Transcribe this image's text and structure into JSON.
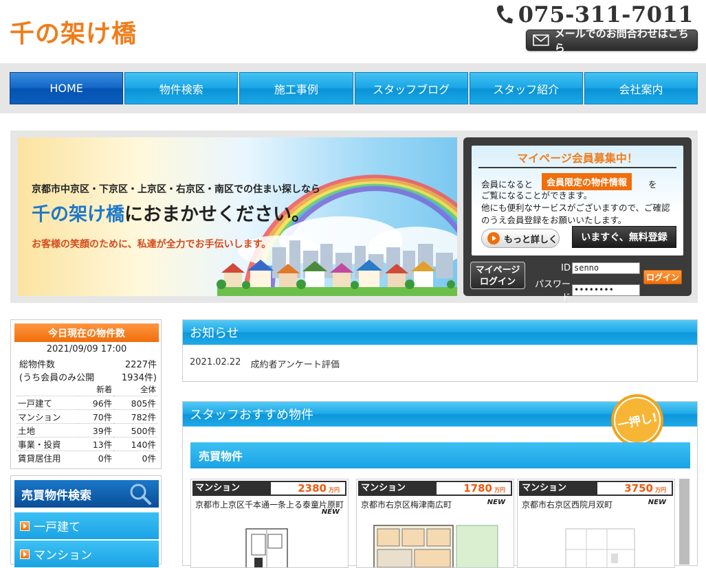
{
  "header": {
    "logo": "千の架け橋",
    "phone": "075-311-7011",
    "mail_button": "メールでのお問合わせはこちら"
  },
  "nav": {
    "items": [
      "HOME",
      "物件検索",
      "施工事例",
      "スタッフブログ",
      "スタッフ紹介",
      "会社案内"
    ],
    "active": "HOME"
  },
  "hero": {
    "line1": "京都市中京区・下京区・上京区・右京区・南区での住まい探しなら",
    "line2_brand": "千の架け橋",
    "line2_rest": "におまかせください。",
    "line3": "お客様の笑顔のために、私達が全力でお手伝いします。"
  },
  "member": {
    "title": "マイページ会員募集中！",
    "text_before_badge": "会員になると",
    "badge": "会員限定の物件情報",
    "text_after_badge": "を",
    "text_lines": [
      "ご覧になることができます。",
      "他にも便利なサービスがございますので、ご確認",
      "のうえ会員登録をお願いいたします。"
    ],
    "more_button": "もっと詳しく",
    "register_button": "いますぐ、無料登録",
    "mypage_line1": "マイページ",
    "mypage_line2": "ログイン",
    "id_label": "ID",
    "id_value": "senno",
    "password_label": "パスワード",
    "password_value": "••••••••",
    "login_button": "ログイン"
  },
  "property_count": {
    "title": "今日現在の物件数",
    "date": "2021/09/09 17:00",
    "total_label": "総物件数",
    "total_value": "2227件",
    "members_label": "(うち会員のみ公開",
    "members_value": "1934件)",
    "col_new": "新着",
    "col_all": "全体",
    "rows": [
      {
        "type": "一戸建て",
        "new": "96件",
        "all": "805件"
      },
      {
        "type": "マンション",
        "new": "70件",
        "all": "782件"
      },
      {
        "type": "土地",
        "new": "39件",
        "all": "500件"
      },
      {
        "type": "事業・投資",
        "new": "13件",
        "all": "140件"
      },
      {
        "type": "賃貸居住用",
        "new": "0件",
        "all": "0件"
      }
    ]
  },
  "search": {
    "title": "売買物件検索",
    "items": [
      "一戸建て",
      "マンション"
    ]
  },
  "news": {
    "title": "お知らせ",
    "items": [
      {
        "date": "2021.02.22",
        "text": "成約者アンケート評価"
      }
    ]
  },
  "staff": {
    "title": "スタッフおすすめ物件",
    "badge": "一押し!",
    "sub_title": "売買物件",
    "listings": [
      {
        "type": "マンション",
        "price": "2380",
        "unit": "万円",
        "address": "京都市上京区千本通一条上る泰童片原町",
        "new": "NEW"
      },
      {
        "type": "マンション",
        "price": "1780",
        "unit": "万円",
        "address": "京都市右京区梅津南広町",
        "new": "NEW"
      },
      {
        "type": "マンション",
        "price": "3750",
        "unit": "万円",
        "address": "京都市右京区西院月双町",
        "new": "NEW"
      }
    ]
  },
  "colors": {
    "brand_orange": "#ef7d1b",
    "nav_blue": "#1aa6e6",
    "nav_active": "#0451b0"
  }
}
